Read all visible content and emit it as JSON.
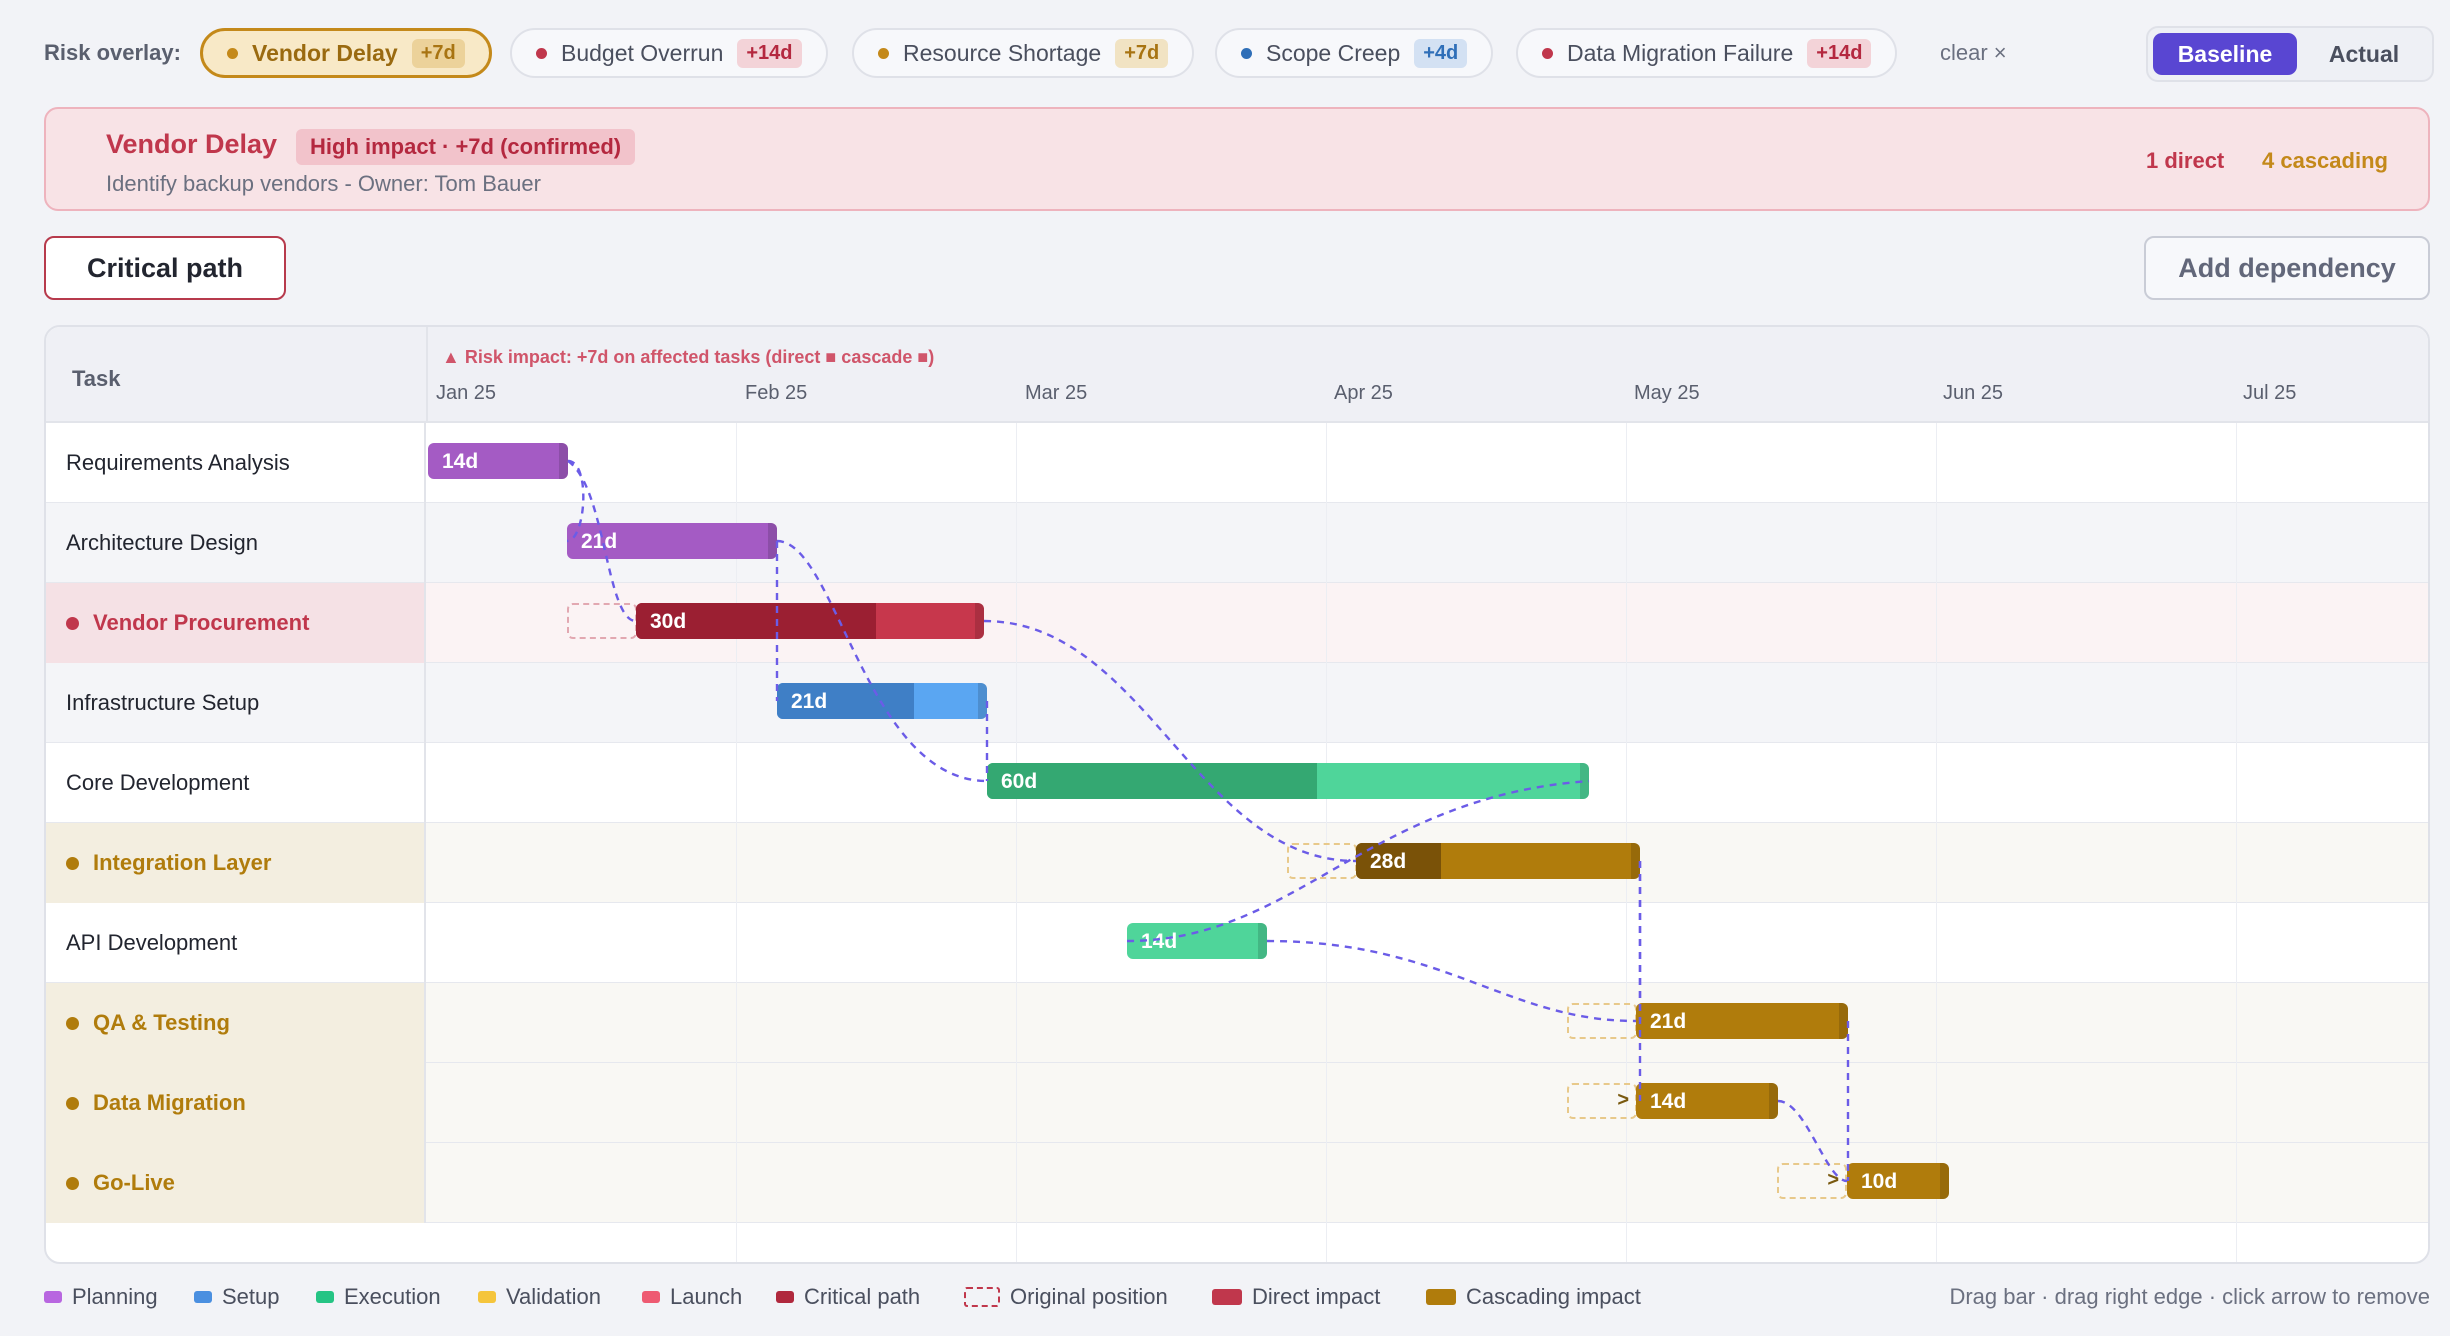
{
  "risk_overlay": {
    "label": "Risk overlay:",
    "chips": [
      {
        "name": "Vendor Delay",
        "delta": "+7d",
        "dot_color": "#c4891a",
        "active": true
      },
      {
        "name": "Budget Overrun",
        "delta": "+14d",
        "dot_color": "#c0374c"
      },
      {
        "name": "Resource Shortage",
        "delta": "+7d",
        "dot_color": "#c4891a"
      },
      {
        "name": "Scope Creep",
        "delta": "+4d",
        "dot_color": "#2f6fb8"
      },
      {
        "name": "Data Migration Failure",
        "delta": "+14d",
        "dot_color": "#c0374c"
      }
    ],
    "clear_label": "clear ×"
  },
  "view_toggle": {
    "baseline": "Baseline",
    "actual": "Actual",
    "selected": "Baseline"
  },
  "risk_detail": {
    "title": "Vendor Delay",
    "badge": "High impact · +7d (confirmed)",
    "subtitle": "Identify backup vendors - Owner: Tom Bauer",
    "direct_count": "1 direct",
    "cascading_count": "4 cascading"
  },
  "buttons": {
    "critical_path": "Critical path",
    "add_dependency": "Add dependency"
  },
  "gantt": {
    "task_header": "Task",
    "impact_note": "▲ Risk impact: +7d on affected tasks (direct ■ cascade ■)",
    "months": [
      "Jan 25",
      "Feb 25",
      "Mar 25",
      "Apr 25",
      "May 25",
      "Jun 25",
      "Jul 25"
    ],
    "tasks": [
      {
        "name": "Requirements Analysis",
        "duration": "14d",
        "category": "Planning",
        "status": "normal"
      },
      {
        "name": "Architecture Design",
        "duration": "21d",
        "category": "Planning",
        "status": "normal"
      },
      {
        "name": "Vendor Procurement",
        "duration": "30d",
        "category": "Critical path",
        "status": "direct"
      },
      {
        "name": "Infrastructure Setup",
        "duration": "21d",
        "category": "Setup",
        "status": "normal"
      },
      {
        "name": "Core Development",
        "duration": "60d",
        "category": "Execution",
        "status": "normal"
      },
      {
        "name": "Integration Layer",
        "duration": "28d",
        "category": "Cascading impact",
        "status": "cascade"
      },
      {
        "name": "API Development",
        "duration": "14d",
        "category": "Execution",
        "status": "normal"
      },
      {
        "name": "QA & Testing",
        "duration": "21d",
        "category": "Cascading impact",
        "status": "cascade"
      },
      {
        "name": "Data Migration",
        "duration": "14d",
        "category": "Cascading impact",
        "status": "cascade"
      },
      {
        "name": "Go-Live",
        "duration": "10d",
        "category": "Cascading impact",
        "status": "cascade"
      }
    ]
  },
  "legend": {
    "items": [
      {
        "label": "Planning",
        "color": "#b866e0"
      },
      {
        "label": "Setup",
        "color": "#4a8fe0"
      },
      {
        "label": "Execution",
        "color": "#25c484"
      },
      {
        "label": "Validation",
        "color": "#f5c53c"
      },
      {
        "label": "Launch",
        "color": "#ee5a72"
      },
      {
        "label": "Critical path",
        "color": "#b0283d"
      },
      {
        "label": "Original position",
        "color": "#c0374c"
      },
      {
        "label": "Direct impact",
        "color": "#c0374c"
      },
      {
        "label": "Cascading impact",
        "color": "#b07c0c"
      }
    ],
    "hint": "Drag bar · drag right edge · click arrow to remove"
  },
  "colors": {
    "accent": "#5946d2",
    "direct": "#c0374c",
    "cascade": "#b07c0c",
    "dependency_line": "#6b5ce7"
  }
}
